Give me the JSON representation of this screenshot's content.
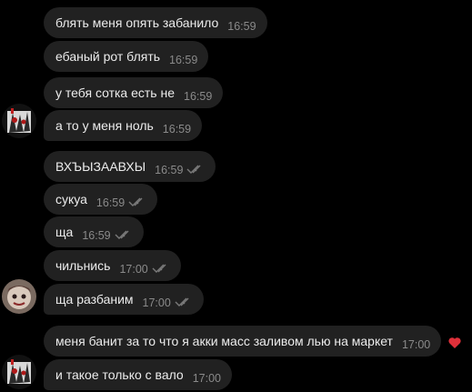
{
  "messages": [
    {
      "text": "блять меня опять забанило",
      "time": "16:59"
    },
    {
      "text": "ебаный рот блять",
      "time": "16:59"
    },
    {
      "text": "у тебя сотка есть не",
      "time": "16:59"
    },
    {
      "text": "а то у меня ноль",
      "time": "16:59"
    },
    {
      "text": "ВХЪЫЗААВХЫ",
      "time": "16:59"
    },
    {
      "text": "сукуа",
      "time": "16:59"
    },
    {
      "text": "ща",
      "time": "16:59"
    },
    {
      "text": "чильнись",
      "time": "17:00"
    },
    {
      "text": "ща разбаним",
      "time": "17:00"
    },
    {
      "text": "меня банит за то что я акки масс заливом лью на маркет",
      "time": "17:00"
    },
    {
      "text": "и такое только с вало",
      "time": "17:00"
    }
  ],
  "reaction": {
    "icon": "heart-icon",
    "color": "#e0303a"
  },
  "colors": {
    "background": "#000000",
    "bubble": "#212121",
    "time": "#8a8a8a",
    "ticks": "#7a7a7a"
  }
}
